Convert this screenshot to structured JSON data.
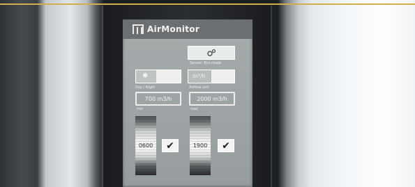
{
  "app": {
    "title": "AirMonitor"
  },
  "controls": {
    "sensor_icon": "gears-icon",
    "sensor_label": "Sensor: Eco mode",
    "day_icon": "sun-icon",
    "day_label": "Day / Night",
    "unit_value": "m³/h",
    "unit_label": "Airflow unit",
    "min_value": "700 m3/h",
    "min_label": "min",
    "max_value": "2000 m3/h",
    "max_label": "max",
    "slider_left_value": "0600",
    "slider_right_value": "1900",
    "confirm_glyph": "✔"
  },
  "colors": {
    "accent_line": "#d3ae4a",
    "screen": "#a3a8aa",
    "titlebar": "#6b6f71"
  }
}
